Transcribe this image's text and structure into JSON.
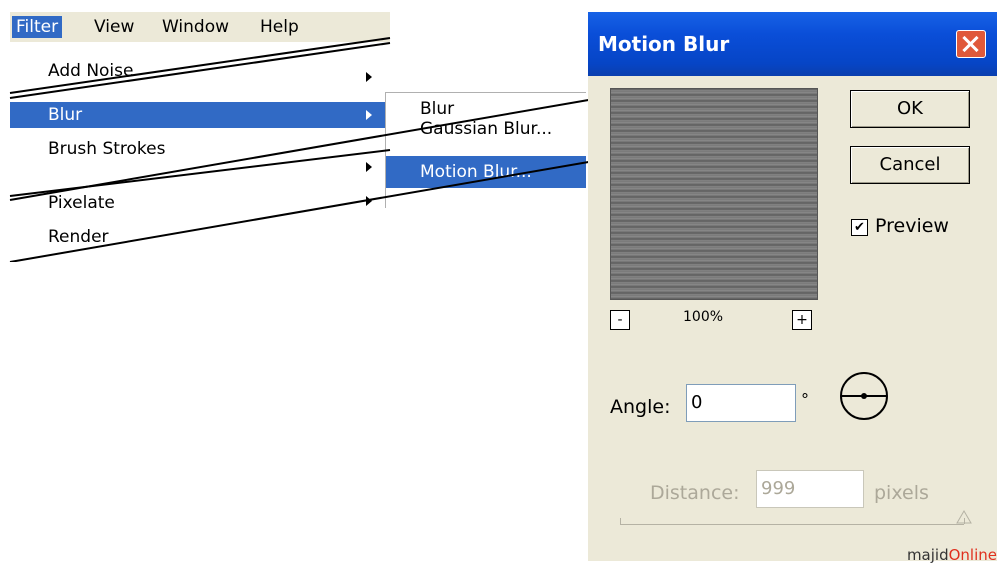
{
  "menubar": {
    "items": [
      {
        "label": "Filter",
        "active": true
      },
      {
        "label": "View",
        "active": false
      },
      {
        "label": "Window",
        "active": false
      },
      {
        "label": "Help",
        "active": false
      }
    ]
  },
  "filter_menu": {
    "items": [
      {
        "label": "Add Noise",
        "submenu": true,
        "selected": false
      },
      {
        "label": "Blur",
        "submenu": true,
        "selected": true
      },
      {
        "label": "Brush Strokes",
        "submenu": true,
        "selected": false
      },
      {
        "label": "Pixelate",
        "submenu": true,
        "selected": false
      },
      {
        "label": "Render",
        "submenu": false,
        "selected": false
      }
    ]
  },
  "blur_submenu": {
    "items": [
      {
        "label": "Blur",
        "selected": false
      },
      {
        "label": "Gaussian Blur...",
        "selected": false
      },
      {
        "label": "Motion Blur...",
        "selected": true
      }
    ]
  },
  "dialog": {
    "title": "Motion Blur",
    "ok_label": "OK",
    "cancel_label": "Cancel",
    "preview_label": "Preview",
    "preview_checked": true,
    "zoom_level": "100%",
    "zoom_minus": "-",
    "zoom_plus": "+",
    "angle_label": "Angle:",
    "angle_value": "0",
    "angle_unit": "°",
    "distance_label": "Distance:",
    "distance_value": "999",
    "distance_unit": "pixels"
  },
  "watermark": {
    "part1": "majid",
    "part2": "Online"
  },
  "colors": {
    "selection": "#316ac5",
    "titlebar": "#0a4ed8",
    "dialog_bg": "#ece9d8",
    "close": "#e0593a"
  }
}
